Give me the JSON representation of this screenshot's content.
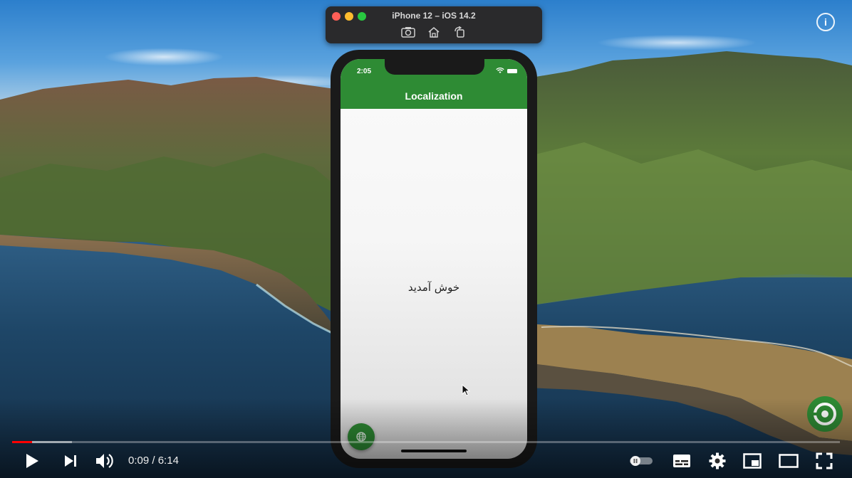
{
  "simulator": {
    "title": "iPhone 12 – iOS 14.2",
    "tools": [
      "screenshot-icon",
      "home-icon",
      "rotate-icon"
    ]
  },
  "phone": {
    "status_time": "2:05",
    "app_title": "Localization",
    "welcome_text": "خوش آمدید",
    "fab_icon": "globe-icon",
    "accent_color": "#2e8b34"
  },
  "player": {
    "current_time": "0:09",
    "separator": " / ",
    "duration": "6:14",
    "played_fraction": 0.024,
    "buffered_fraction": 0.072,
    "progress_color": "#ff0000",
    "controls": [
      "play-icon",
      "next-icon",
      "volume-icon",
      "autoplay-toggle",
      "subtitles-icon",
      "settings-icon",
      "miniplayer-icon",
      "theater-icon",
      "fullscreen-icon"
    ],
    "info_icon_label": "i"
  }
}
